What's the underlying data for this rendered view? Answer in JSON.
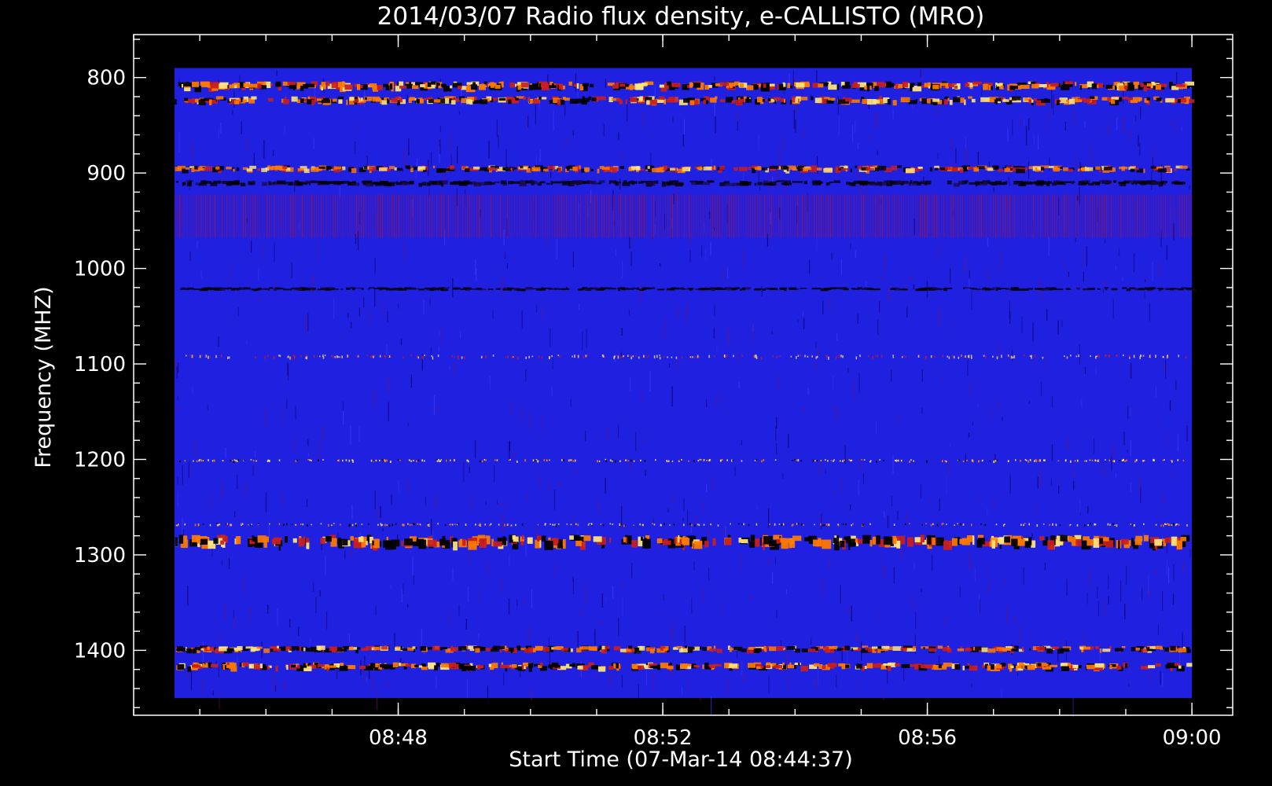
{
  "chart_data": {
    "type": "heatmap",
    "title": "2014/03/07  Radio flux density, e-CALLISTO (MRO)",
    "xlabel": "Start Time (07-Mar-14 08:44:37)",
    "ylabel": "Frequency (MHZ)",
    "x_tick_labels": [
      "08:48",
      "08:52",
      "08:56",
      "09:00"
    ],
    "x_tick_values_min": [
      3.3833,
      7.3833,
      11.3833,
      15.3833
    ],
    "x_range_min": [
      -0.6167,
      16.0
    ],
    "data_range_min": [
      0.0,
      15.3833
    ],
    "y_tick_labels": [
      "800",
      "900",
      "1000",
      "1100",
      "1200",
      "1300",
      "1400"
    ],
    "y_tick_values": [
      800,
      900,
      1000,
      1100,
      1200,
      1300,
      1400
    ],
    "ylim": [
      755,
      1468
    ],
    "data_freq_range": [
      790,
      1450
    ],
    "y_inverted": true,
    "colormap": [
      "#000000",
      "#1a00c8",
      "#2a2af0",
      "#c81e1e",
      "#ff7a00",
      "#ffe680"
    ],
    "background_color": "#2020e0",
    "bands": [
      {
        "center": 808,
        "width": 8,
        "intensity": 0.85,
        "kind": "bright-and-dark"
      },
      {
        "center": 823,
        "width": 7,
        "intensity": 0.75,
        "kind": "bright-and-dark"
      },
      {
        "center": 895,
        "width": 6,
        "intensity": 0.6,
        "kind": "bright-and-dark"
      },
      {
        "center": 910,
        "width": 5,
        "intensity": 0.4,
        "kind": "dark"
      },
      {
        "center": 945,
        "width": 45,
        "intensity": 0.35,
        "kind": "reddish-striped"
      },
      {
        "center": 1021,
        "width": 3,
        "intensity": 0.5,
        "kind": "dark"
      },
      {
        "center": 1092,
        "width": 4,
        "intensity": 0.4,
        "kind": "dotted"
      },
      {
        "center": 1201,
        "width": 3,
        "intensity": 0.8,
        "kind": "dotted-bright"
      },
      {
        "center": 1268,
        "width": 3,
        "intensity": 0.6,
        "kind": "dotted-bright"
      },
      {
        "center": 1285,
        "width": 12,
        "intensity": 0.85,
        "kind": "bright-and-dark"
      },
      {
        "center": 1398,
        "width": 6,
        "intensity": 0.7,
        "kind": "bright-and-dark"
      },
      {
        "center": 1416,
        "width": 7,
        "intensity": 0.85,
        "kind": "bright-and-dark"
      }
    ]
  }
}
